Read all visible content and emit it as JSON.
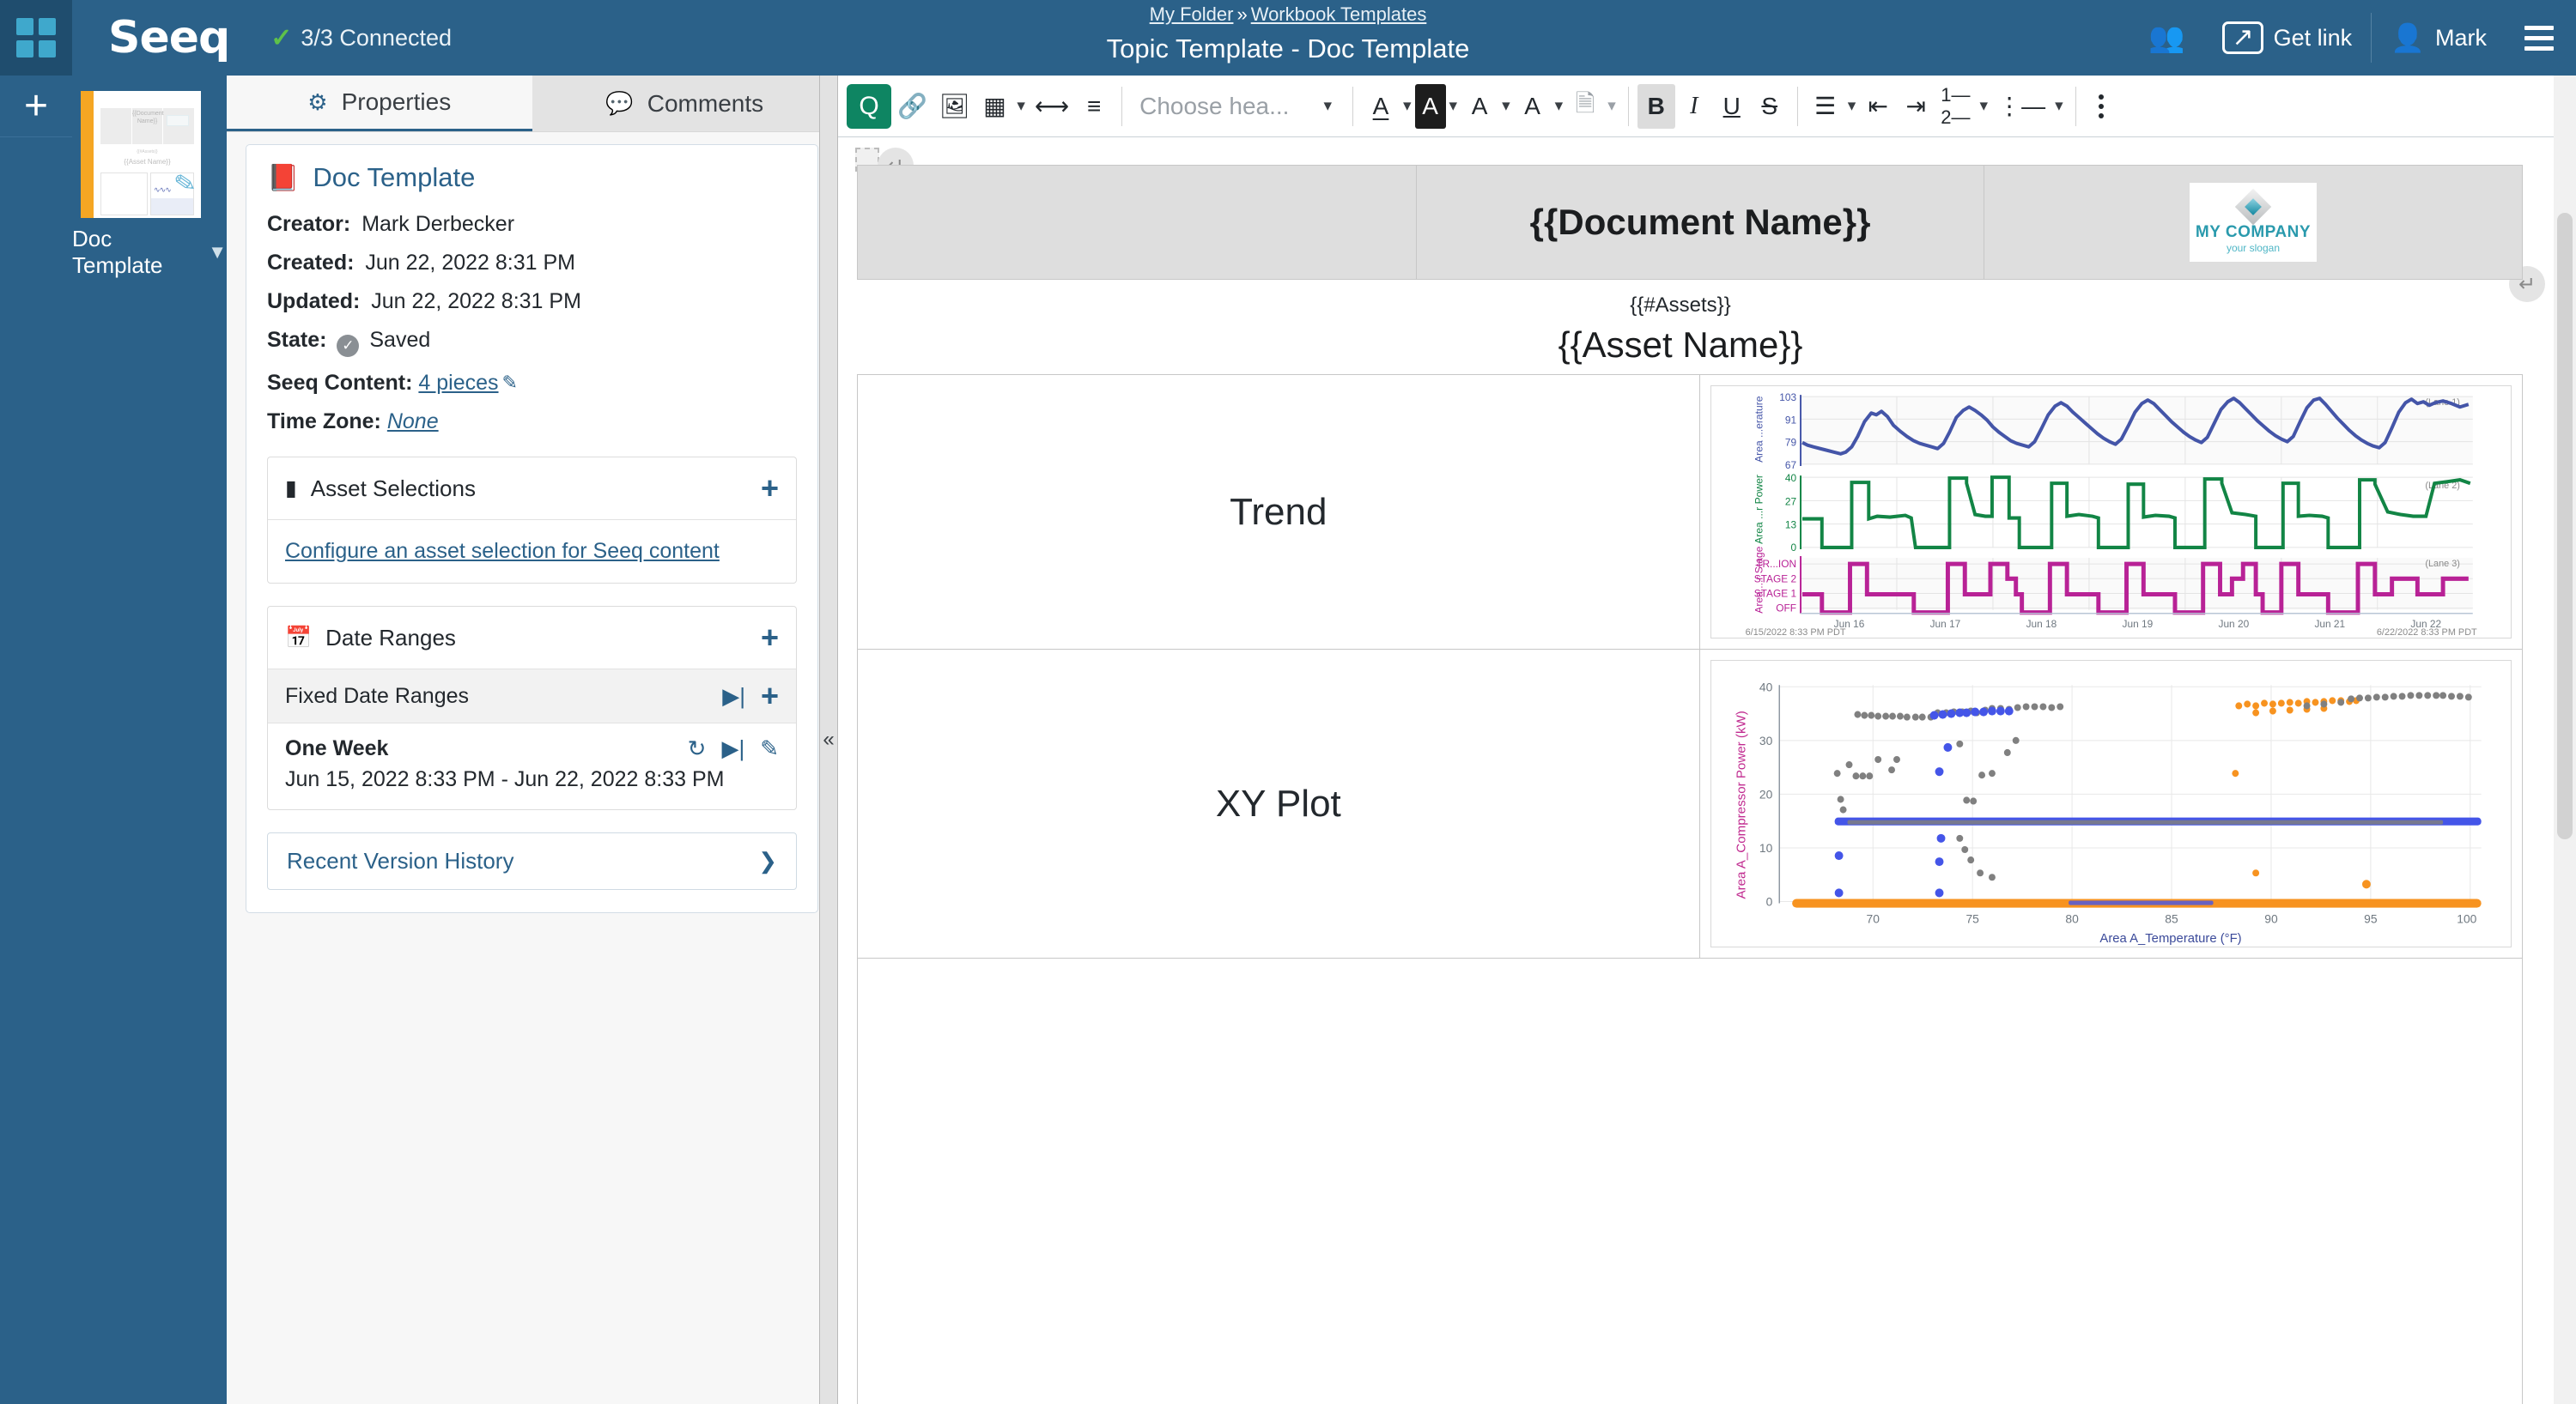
{
  "header": {
    "brand": "Seeq",
    "connection_status": "3/3 Connected",
    "breadcrumb": {
      "folder": "My Folder",
      "separator": "»",
      "parent": "Workbook Templates"
    },
    "document_title": "Topic Template - Doc Template",
    "get_link_label": "Get link",
    "user_name": "Mark"
  },
  "sidebar": {
    "add_label": "+",
    "document": {
      "name": "Doc Template",
      "thumb_doc_name": "{{Document Name}}",
      "thumb_assets": "{{#Assets}}",
      "thumb_asset_name": "{{Asset Name}}"
    }
  },
  "panel": {
    "tabs": [
      {
        "label": "Properties",
        "icon": "gear-icon",
        "active": true
      },
      {
        "label": "Comments",
        "icon": "comment-icon",
        "active": false
      }
    ],
    "doc_card": {
      "title": "Doc Template",
      "rows": [
        {
          "label": "Creator:",
          "value": "Mark Derbecker"
        },
        {
          "label": "Created:",
          "value": "Jun 22, 2022 8:31 PM"
        },
        {
          "label": "Updated:",
          "value": "Jun 22, 2022 8:31 PM"
        },
        {
          "label": "State:",
          "value": "Saved"
        },
        {
          "label": "Seeq Content:",
          "value": "4 pieces"
        },
        {
          "label": "Time Zone:",
          "value": "None"
        }
      ]
    },
    "asset_selections": {
      "title": "Asset Selections",
      "add_label": "+",
      "empty_link": "Configure an asset selection for Seeq content"
    },
    "date_ranges": {
      "title": "Date Ranges",
      "add_label": "+",
      "fixed_label": "Fixed Date Ranges",
      "items": [
        {
          "name": "One Week",
          "range": "Jun 15, 2022 8:33 PM - Jun 22, 2022 8:33 PM"
        }
      ]
    },
    "version_history": {
      "label": "Recent Version History"
    }
  },
  "toolbar": {
    "seeq_content_label": "Q",
    "heading_placeholder": "Choose hea...",
    "bold_label": "B",
    "italic_label": "I",
    "underline_label": "U",
    "strike_label": "S",
    "font_color_label": "A",
    "highlight_label": "A",
    "font_family_label": "A",
    "font_size_label": "A"
  },
  "document": {
    "header_table": {
      "center_title": "{{Document Name}}",
      "logo": {
        "company": "MY COMPANY",
        "company_prefix": "MY ",
        "slogan": "your slogan"
      }
    },
    "assets_tag": "{{#Assets}}",
    "asset_name": "{{Asset Name}}",
    "rows": [
      {
        "label": "Trend",
        "content": "trend-chart"
      },
      {
        "label": "XY Plot",
        "content": "xy-plot-chart"
      }
    ]
  },
  "chart_data": [
    {
      "type": "line",
      "name": "trend-chart",
      "title": "",
      "xlabel": "",
      "x_ticks": [
        "Jun 16",
        "Jun 17",
        "Jun 18",
        "Jun 19",
        "Jun 20",
        "Jun 21",
        "Jun 22"
      ],
      "start_label": "6/15/2022 8:33 PM  PDT",
      "end_label": "6/22/2022 8:33 PM  PDT",
      "lanes": [
        {
          "lane_label": "(Lane 1)",
          "ylabel": "Area ...erature",
          "color": "#4455a8",
          "y_ticks": [
            67,
            79,
            91,
            103
          ],
          "ylim": [
            62,
            108
          ],
          "values": [
            78,
            76,
            75,
            74,
            73,
            72,
            71,
            70,
            69,
            71,
            76,
            85,
            93,
            97,
            96,
            98,
            95,
            90,
            86,
            83,
            80,
            78,
            77,
            76,
            75,
            78,
            84,
            92,
            97,
            99,
            97,
            95,
            92,
            88,
            85,
            82,
            80,
            78,
            77,
            76,
            79,
            86,
            94,
            99,
            101,
            99,
            96,
            93,
            89,
            86,
            83,
            81,
            79,
            78,
            80,
            87,
            95,
            100,
            102,
            100,
            97,
            94,
            90,
            87,
            84,
            82,
            80,
            79,
            81,
            88,
            96,
            101,
            103,
            101,
            98,
            94,
            91,
            88,
            85,
            83,
            81,
            80,
            82,
            89,
            97,
            102,
            103,
            100,
            96,
            92,
            88,
            85,
            82,
            80,
            79,
            78,
            80,
            88,
            98,
            103
          ]
        },
        {
          "lane_label": "(Lane 2)",
          "ylabel": "Area ...r Power",
          "color": "#128545",
          "y_ticks": [
            0,
            13,
            27,
            40
          ],
          "ylim": [
            0,
            43
          ],
          "values": [
            16,
            16,
            16,
            16,
            0,
            0,
            0,
            0,
            0,
            0,
            37,
            37,
            17,
            18,
            19,
            18,
            19,
            18,
            17,
            0,
            0,
            0,
            0,
            0,
            0,
            0,
            40,
            40,
            38,
            18,
            19,
            18,
            41,
            41,
            41,
            17,
            17,
            0,
            0,
            0,
            0,
            0,
            0,
            0,
            0,
            38,
            38,
            18,
            19,
            18,
            18,
            0,
            0,
            0,
            0,
            0,
            0,
            37,
            37,
            17,
            18,
            19,
            18,
            17,
            0,
            0,
            0,
            0,
            0,
            0,
            0,
            40,
            40,
            39,
            19,
            19,
            18,
            0,
            0,
            0,
            0,
            0,
            0,
            38,
            38,
            18,
            19,
            18,
            0,
            0,
            0,
            0,
            0,
            0,
            0,
            40,
            40,
            40,
            39,
            38
          ]
        },
        {
          "lane_label": "(Lane 3)",
          "ylabel": "Area ...r Stage",
          "color": "#b82296",
          "y_ticks": [
            "OFF",
            "STAGE 1",
            "STAGE 2",
            "TR...ION"
          ],
          "ylim": [
            0,
            3
          ],
          "values": [
            1,
            1,
            1,
            1,
            0,
            0,
            0,
            0,
            0,
            0,
            3,
            3,
            1,
            1,
            1,
            1,
            1,
            1,
            1,
            0,
            0,
            0,
            0,
            0,
            0,
            0,
            3,
            3,
            2,
            1,
            1,
            1,
            3,
            3,
            3,
            1,
            1,
            0,
            0,
            0,
            0,
            0,
            0,
            0,
            0,
            3,
            3,
            1,
            1,
            1,
            1,
            0,
            0,
            0,
            0,
            0,
            0,
            3,
            3,
            1,
            1,
            1,
            1,
            1,
            0,
            0,
            0,
            0,
            0,
            0,
            0,
            3,
            3,
            2,
            1,
            1,
            1,
            0,
            0,
            0,
            0,
            0,
            0,
            3,
            3,
            1,
            1,
            1,
            0,
            0,
            0,
            0,
            0,
            0,
            0,
            3,
            3,
            3,
            2,
            2
          ]
        }
      ]
    },
    {
      "type": "scatter",
      "name": "xy-plot-chart",
      "title": "",
      "xlabel": "Area A_Temperature (°F)",
      "ylabel": "Area A_Compressor Power (kW)",
      "x_ticks": [
        70,
        75,
        80,
        85,
        90,
        95,
        100
      ],
      "y_ticks": [
        0,
        10,
        20,
        30,
        40
      ],
      "xlim": [
        66,
        103
      ],
      "ylim": [
        0,
        42
      ],
      "series": [
        {
          "name": "series-blue",
          "color": "#4455e8"
        },
        {
          "name": "series-gray",
          "color": "#808080"
        },
        {
          "name": "series-orange",
          "color": "#f79320"
        }
      ]
    }
  ]
}
